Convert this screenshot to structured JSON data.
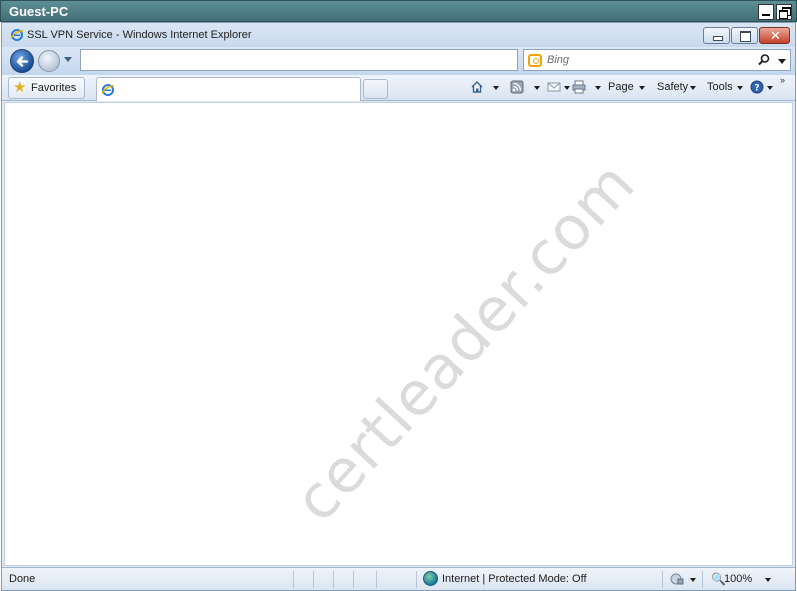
{
  "outer_window": {
    "title": "Guest-PC"
  },
  "browser": {
    "title": "SSL VPN Service - Windows Internet Explorer",
    "address": {
      "value": ""
    },
    "search": {
      "placeholder": "Bing"
    },
    "favorites_label": "Favorites",
    "tab_title": "",
    "toolbar": {
      "page_label": "Page",
      "safety_label": "Safety",
      "tools_label": "Tools"
    },
    "watermark": "certleader.com",
    "status": {
      "text": "Done",
      "zone": "Internet | Protected Mode: Off",
      "zoom": "100%"
    }
  },
  "colors": {
    "outer_title": "#4f7f86",
    "chrome": "#dbe6f4",
    "close_button": "#c4412b"
  }
}
